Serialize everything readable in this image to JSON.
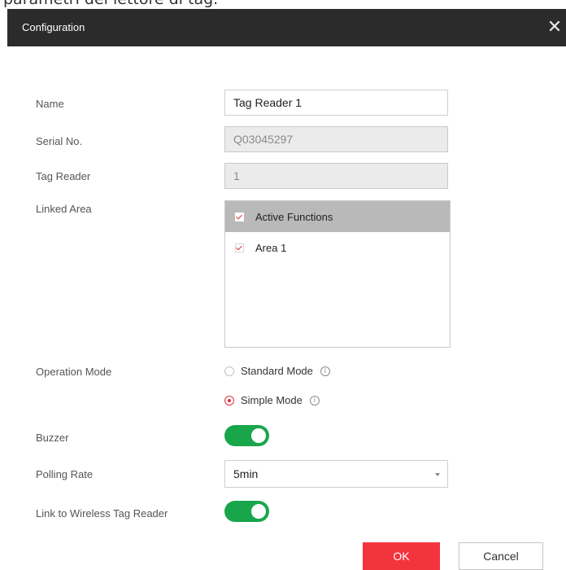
{
  "top_caption": "parametri del lettore di tag.",
  "dialog": {
    "title": "Configuration",
    "close_symbol": "✕"
  },
  "fields": {
    "name_label": "Name",
    "name_value": "Tag Reader 1",
    "serial_label": "Serial No.",
    "serial_value": "Q03045297",
    "tag_reader_label": "Tag Reader",
    "tag_reader_value": "1"
  },
  "linked_area": {
    "label": "Linked Area",
    "items": [
      {
        "label": "Active Functions",
        "checked": true
      },
      {
        "label": "Area 1",
        "checked": true
      }
    ]
  },
  "operation_mode": {
    "label": "Operation Mode",
    "options": [
      {
        "label": "Standard Mode",
        "selected": false
      },
      {
        "label": "Simple Mode",
        "selected": true
      }
    ],
    "info_glyph": "i"
  },
  "buzzer": {
    "label": "Buzzer",
    "on": true
  },
  "polling_rate": {
    "label": "Polling Rate",
    "value": "5min"
  },
  "link_wireless": {
    "label": "Link to Wireless Tag Reader",
    "on": true
  },
  "buttons": {
    "ok": "OK",
    "cancel": "Cancel"
  },
  "colors": {
    "titlebar": "#2b2b2b",
    "accent_red": "#f3343e",
    "toggle_green": "#19a64b",
    "list_header": "#b9b9b9"
  },
  "icons": [
    "close-icon",
    "checkbox-checked",
    "radio",
    "info-icon",
    "chevron-down-icon",
    "toggle-switch"
  ]
}
